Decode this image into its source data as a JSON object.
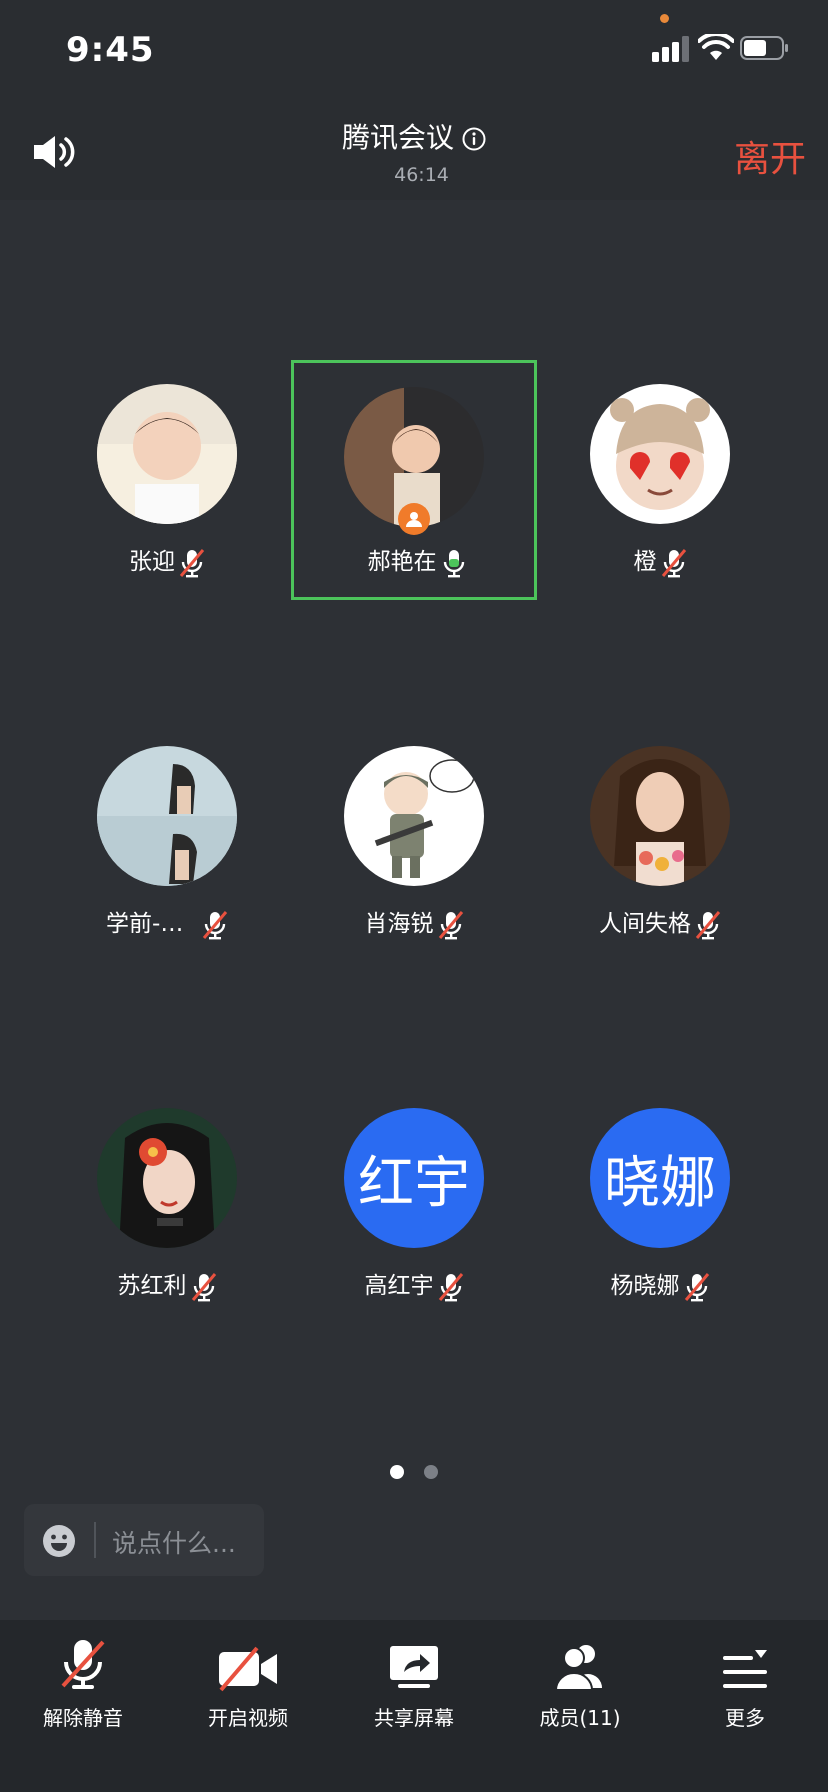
{
  "status_bar": {
    "time": "9:45"
  },
  "header": {
    "title": "腾讯会议",
    "timer": "46:14",
    "leave_label": "离开"
  },
  "participants": [
    {
      "name": "张迎",
      "mic": "muted",
      "avatar": "photo-child",
      "active": false
    },
    {
      "name": "郝艳在",
      "mic": "on",
      "avatar": "photo-toddler",
      "active": true,
      "host": true
    },
    {
      "name": "橙",
      "mic": "muted",
      "avatar": "memoji-heart-eyes",
      "active": false
    },
    {
      "name": "学前-…",
      "mic": "muted",
      "avatar": "photo-man",
      "active": false
    },
    {
      "name": "肖海锐",
      "mic": "muted",
      "avatar": "cartoon-soldier",
      "active": false
    },
    {
      "name": "人间失格",
      "mic": "muted",
      "avatar": "photo-woman",
      "active": false
    },
    {
      "name": "苏红利",
      "mic": "muted",
      "avatar": "illustration-flower-girl",
      "active": false
    },
    {
      "name": "高红宇",
      "mic": "muted",
      "avatar_text": "红宇",
      "active": false
    },
    {
      "name": "杨晓娜",
      "mic": "muted",
      "avatar_text": "晓娜",
      "active": false
    }
  ],
  "pager": {
    "pages": 2,
    "current": 1
  },
  "chat": {
    "placeholder": "说点什么..."
  },
  "toolbar": {
    "unmute_label": "解除静音",
    "video_label": "开启视频",
    "share_label": "共享屏幕",
    "members_label": "成员(11)",
    "more_label": "更多"
  },
  "colors": {
    "leave": "#e8513f",
    "active_border": "#4cc45b",
    "text_avatar": "#2a6bf2",
    "host_badge": "#f07b2a"
  }
}
